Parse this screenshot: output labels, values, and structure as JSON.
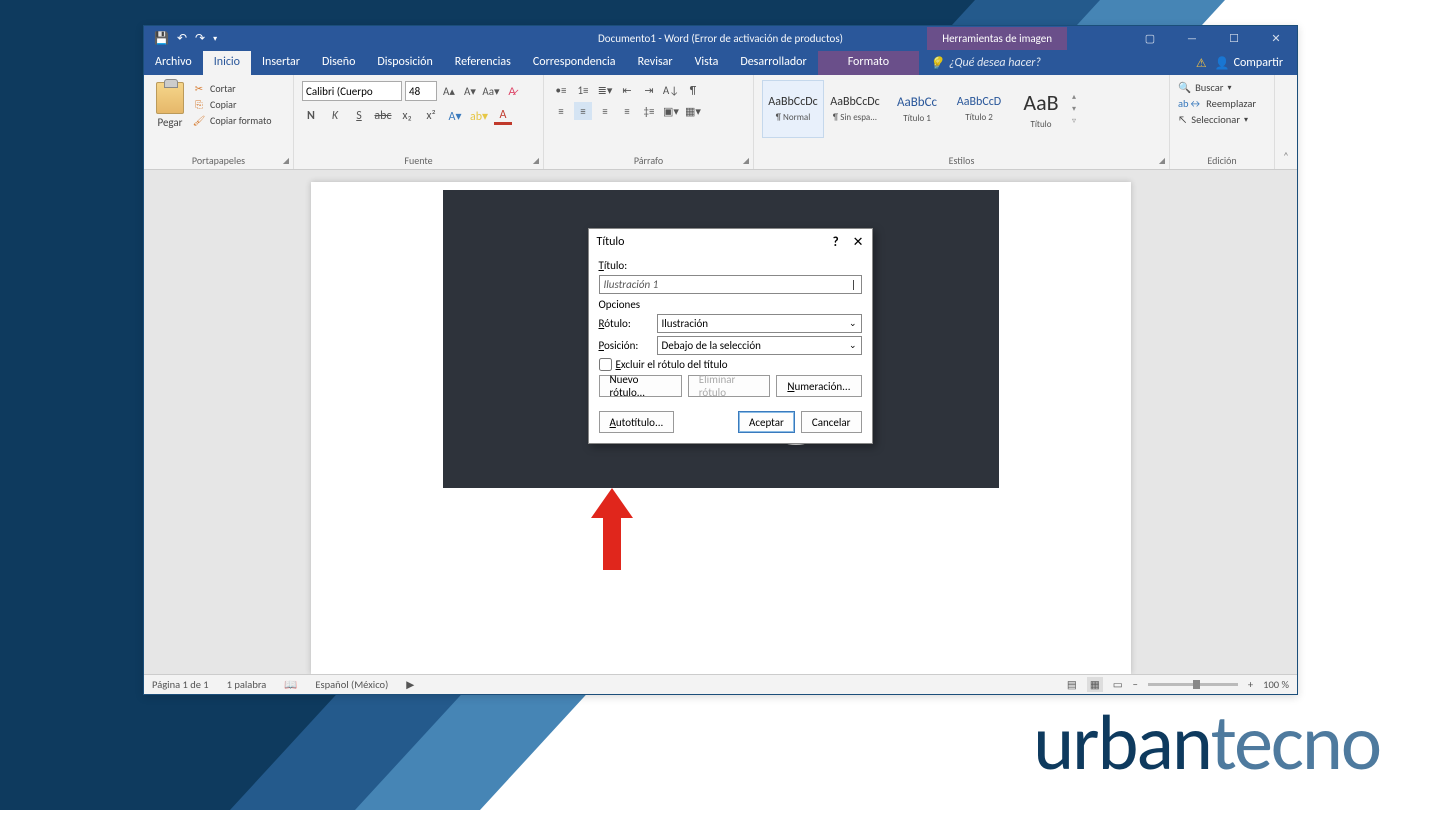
{
  "title_window": "Documento1 - Word (Error de activación de productos)",
  "context_tab": "Herramientas de imagen",
  "menu": {
    "archivo": "Archivo",
    "inicio": "Inicio",
    "insertar": "Insertar",
    "diseno": "Diseño",
    "disposicion": "Disposición",
    "referencias": "Referencias",
    "corresp": "Correspondencia",
    "revisar": "Revisar",
    "vista": "Vista",
    "desarrollador": "Desarrollador",
    "formato": "Formato"
  },
  "tell_me": "¿Qué desea hacer?",
  "share": "Compartir",
  "ribbon": {
    "clipboard": {
      "paste": "Pegar",
      "cut": "Cortar",
      "copy": "Copiar",
      "fmt": "Copiar formato",
      "label": "Portapapeles"
    },
    "font": {
      "name": "Calibri (Cuerpo",
      "size": "48",
      "label": "Fuente"
    },
    "paragraph_label": "Párrafo",
    "styles": {
      "label": "Estilos",
      "items": [
        {
          "preview": "AaBbCcDc",
          "name": "¶ Normal",
          "size": "12px"
        },
        {
          "preview": "AaBbCcDc",
          "name": "¶ Sin espa...",
          "size": "12px"
        },
        {
          "preview": "AaBbCc",
          "name": "Título 1",
          "size": "13px",
          "color": "#2a579a"
        },
        {
          "preview": "AaBbCcD",
          "name": "Título 2",
          "size": "12px",
          "color": "#2a579a"
        },
        {
          "preview": "AaB",
          "name": "Título",
          "size": "22px"
        }
      ]
    },
    "editing": {
      "find": "Buscar",
      "replace": "Reemplazar",
      "select": "Seleccionar",
      "label": "Edición"
    }
  },
  "dialog": {
    "title": "Título",
    "lbl_titulo": "Título:",
    "val_titulo": "Ilustración 1",
    "opciones": "Opciones",
    "lbl_rotulo": "Rótulo:",
    "val_rotulo": "Ilustración",
    "lbl_posicion": "Posición:",
    "val_posicion": "Debajo de la selección",
    "excluir": "Excluir el rótulo del título",
    "nuevo": "Nuevo rótulo...",
    "eliminar": "Eliminar rótulo",
    "numeracion": "Numeración...",
    "autotitulo": "Autotítulo...",
    "aceptar": "Aceptar",
    "cancelar": "Cancelar"
  },
  "status": {
    "page": "Página 1 de 1",
    "words": "1 palabra",
    "lang": "Español (México)",
    "zoom": "100 %"
  },
  "brand": {
    "p1": "urban",
    "p2": "tecno"
  }
}
